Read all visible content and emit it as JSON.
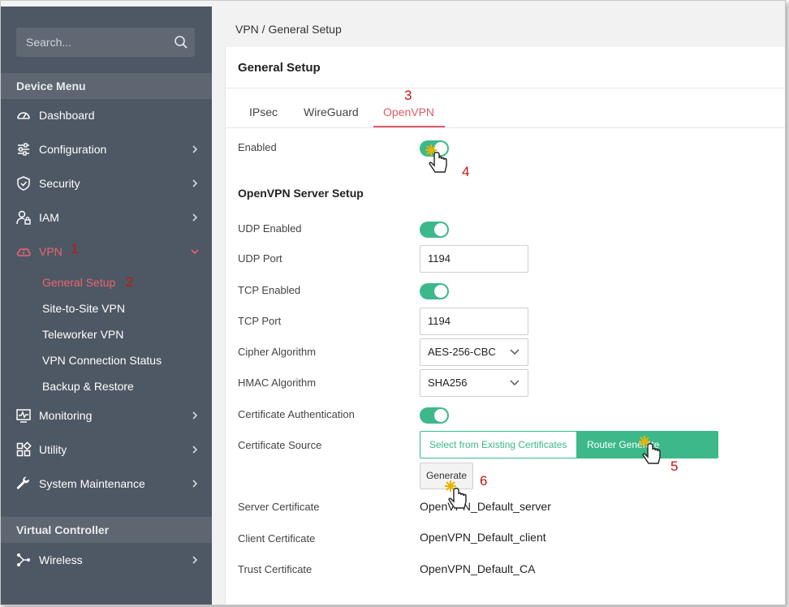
{
  "sidebar": {
    "search_placeholder": "Search...",
    "device_menu_heading": "Device Menu",
    "items": [
      {
        "label": "Dashboard",
        "icon": "gauge-icon"
      },
      {
        "label": "Configuration",
        "icon": "sliders-icon"
      },
      {
        "label": "Security",
        "icon": "shield-icon"
      },
      {
        "label": "IAM",
        "icon": "user-lock-icon"
      },
      {
        "label": "VPN",
        "icon": "cloud-lock-icon"
      },
      {
        "label": "Monitoring",
        "icon": "monitor-pulse-icon"
      },
      {
        "label": "Utility",
        "icon": "grid-icon"
      },
      {
        "label": "System Maintenance",
        "icon": "wrench-icon"
      }
    ],
    "vpn_submenu": [
      "General Setup",
      "Site-to-Site VPN",
      "Teleworker VPN",
      "VPN Connection Status",
      "Backup & Restore"
    ],
    "virtual_controller_heading": "Virtual Controller",
    "vc_items": [
      {
        "label": "Wireless",
        "icon": "network-icon"
      }
    ]
  },
  "breadcrumb": "VPN / General Setup",
  "card": {
    "title": "General Setup",
    "tabs": [
      "IPsec",
      "WireGuard",
      "OpenVPN"
    ],
    "enabled_label": "Enabled",
    "server_setup_title": "OpenVPN Server Setup",
    "udp_enabled_label": "UDP Enabled",
    "udp_port_label": "UDP Port",
    "udp_port_value": "1194",
    "tcp_enabled_label": "TCP Enabled",
    "tcp_port_label": "TCP Port",
    "tcp_port_value": "1194",
    "cipher_label": "Cipher Algorithm",
    "cipher_value": "AES-256-CBC",
    "hmac_label": "HMAC Algorithm",
    "hmac_value": "SHA256",
    "cert_auth_label": "Certificate Authentication",
    "cert_source_label": "Certificate Source",
    "cert_source_options": [
      "Select from Existing Certificates",
      "Router Generate Certificates"
    ],
    "generate_button": "Generate",
    "server_cert_label": "Server Certificate",
    "server_cert_value": "OpenVPN_Default_server",
    "client_cert_label": "Client Certificate",
    "client_cert_value": "OpenVPN_Default_client",
    "trust_cert_label": "Trust Certificate",
    "trust_cert_value": "OpenVPN_Default_CA"
  },
  "annotations": [
    "1",
    "2",
    "3",
    "4",
    "5",
    "6"
  ],
  "colors": {
    "sidebar_bg": "#4e5864",
    "accent_red": "#e05a67",
    "toggle_green": "#3db88a",
    "annotation_red": "#c01515"
  }
}
